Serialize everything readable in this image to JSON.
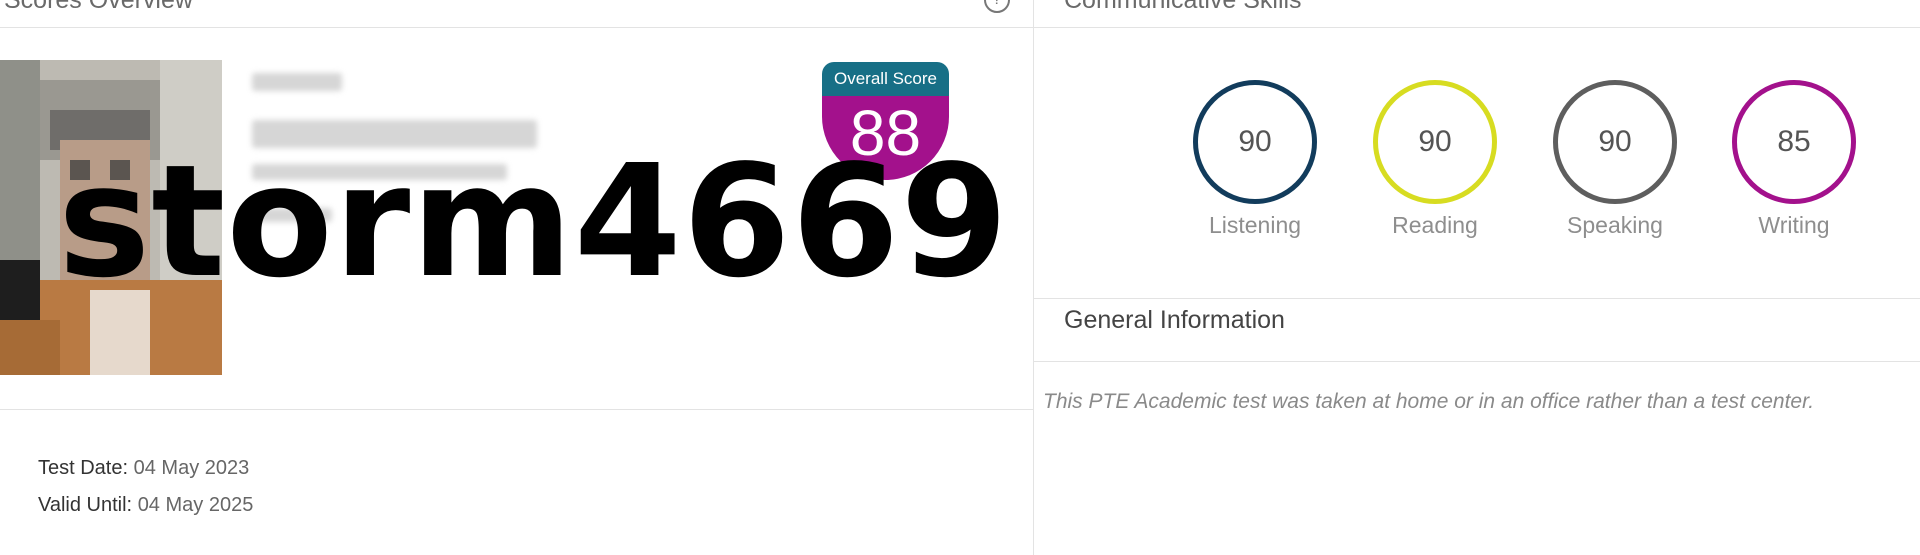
{
  "scores_overview": {
    "title": "Scores Overview",
    "help_icon": "question-circle-icon",
    "overall_score_label": "Overall Score",
    "overall_score": "88",
    "username_overlay": "storm4669",
    "test_date_label": "Test Date:",
    "test_date": "04 May 2023",
    "valid_until_label": "Valid Until:",
    "valid_until": "04 May 2025"
  },
  "communicative_skills": {
    "title": "Communicative Skills",
    "skills": [
      {
        "label": "Listening",
        "score": "90",
        "color": "#123c5c"
      },
      {
        "label": "Reading",
        "score": "90",
        "color": "#d7dc21"
      },
      {
        "label": "Speaking",
        "score": "90",
        "color": "#5e5e5e"
      },
      {
        "label": "Writing",
        "score": "85",
        "color": "#a3118c"
      }
    ]
  },
  "general_information": {
    "title": "General Information",
    "note": "This PTE Academic test was taken at home or in an office rather than a test center."
  },
  "colors": {
    "badge_header": "#176f86",
    "badge_body": "#a3118c",
    "divider": "#e3e3e3"
  }
}
